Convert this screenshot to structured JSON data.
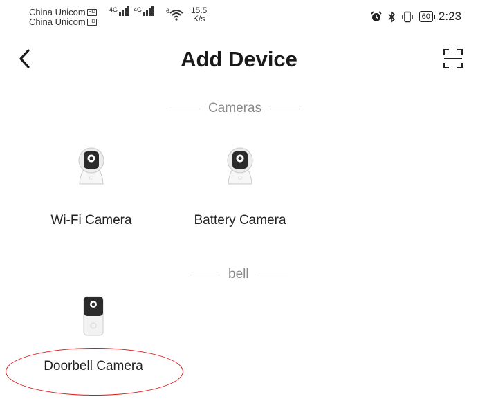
{
  "status_bar": {
    "carrier_1": "China Unicom",
    "carrier_2": "China Unicom",
    "hd_badge": "HD",
    "network_1": "4G",
    "network_2": "4G",
    "wifi_label": "6",
    "speed_value": "15.5",
    "speed_unit": "K/s",
    "battery": "60",
    "time": "2:23",
    "icons": [
      "signal-icon",
      "signal-icon",
      "wifi-icon",
      "alarm-icon",
      "bluetooth-icon",
      "vibrate-icon",
      "battery-icon"
    ]
  },
  "header": {
    "back_icon": "chevron-left-icon",
    "title": "Add Device",
    "scan_icon": "scan-icon"
  },
  "sections": {
    "cameras": {
      "title": "Cameras",
      "items": [
        {
          "label": "Wi-Fi Camera",
          "icon": "camera-icon"
        },
        {
          "label": "Battery Camera",
          "icon": "camera-icon"
        }
      ]
    },
    "bell": {
      "title": "bell",
      "items": [
        {
          "label": "Doorbell Camera",
          "icon": "doorbell-icon"
        }
      ]
    }
  },
  "annotation": {
    "highlight_color": "#e01010"
  }
}
